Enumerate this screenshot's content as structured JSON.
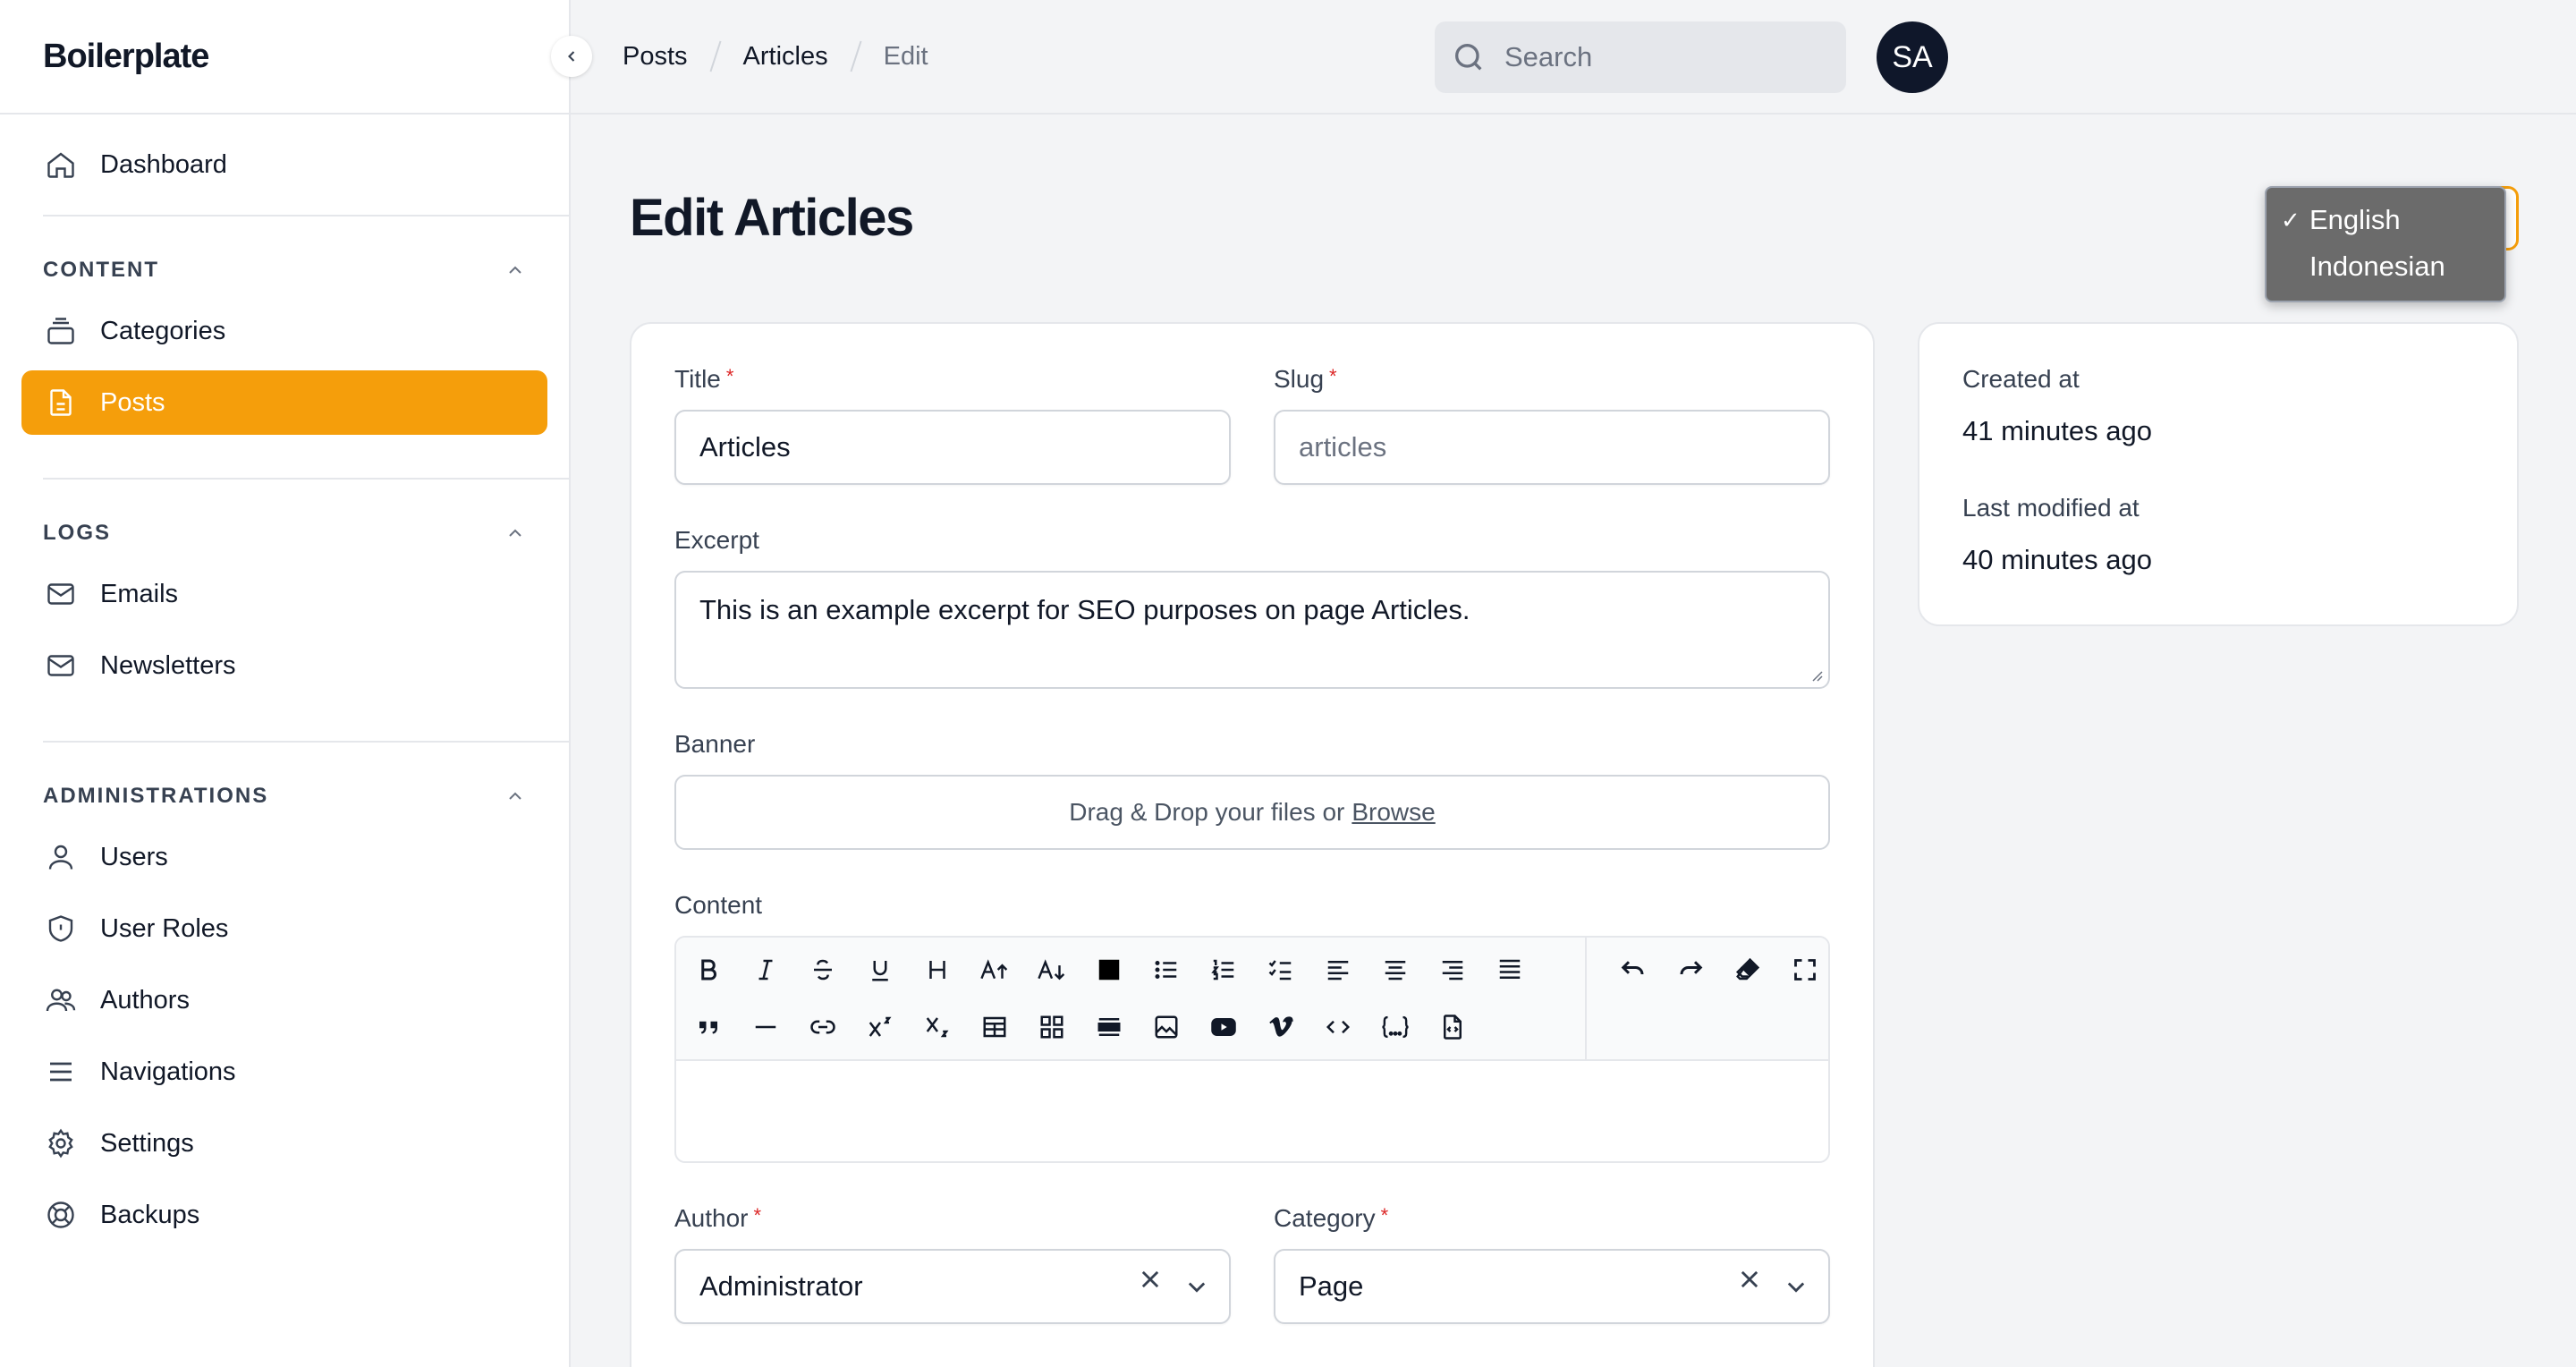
{
  "brand": "Boilerplate",
  "sidebar": {
    "dashboard": "Dashboard",
    "groups": [
      {
        "label": "CONTENT",
        "items": [
          "Categories",
          "Posts"
        ]
      },
      {
        "label": "LOGS",
        "items": [
          "Emails",
          "Newsletters"
        ]
      },
      {
        "label": "ADMINISTRATIONS",
        "items": [
          "Users",
          "User Roles",
          "Authors",
          "Navigations",
          "Settings",
          "Backups"
        ]
      }
    ],
    "active_item": "Posts"
  },
  "breadcrumb": [
    "Posts",
    "Articles",
    "Edit"
  ],
  "search": {
    "placeholder": "Search"
  },
  "user": {
    "initials": "SA"
  },
  "page_title": "Edit Articles",
  "locale": {
    "options": [
      "English",
      "Indonesian"
    ],
    "selected": "English",
    "check": "✓"
  },
  "form": {
    "title": {
      "label": "Title",
      "value": "Articles",
      "required": "*"
    },
    "slug": {
      "label": "Slug",
      "value": "articles",
      "required": "*"
    },
    "excerpt": {
      "label": "Excerpt",
      "value": "This is an example excerpt for SEO purposes on page Articles."
    },
    "banner": {
      "label": "Banner",
      "dropzone_text": "Drag & Drop your files or",
      "browse": "Browse"
    },
    "content": {
      "label": "Content"
    },
    "author": {
      "label": "Author",
      "value": "Administrator",
      "required": "*"
    },
    "category": {
      "label": "Category",
      "value": "Page",
      "required": "*"
    }
  },
  "meta": {
    "created_label": "Created at",
    "created_value": "41 minutes ago",
    "modified_label": "Last modified at",
    "modified_value": "40 minutes ago"
  },
  "colors": {
    "accent": "#f59e0b",
    "required": "#dc2626",
    "avatar_bg": "#0f172a"
  }
}
